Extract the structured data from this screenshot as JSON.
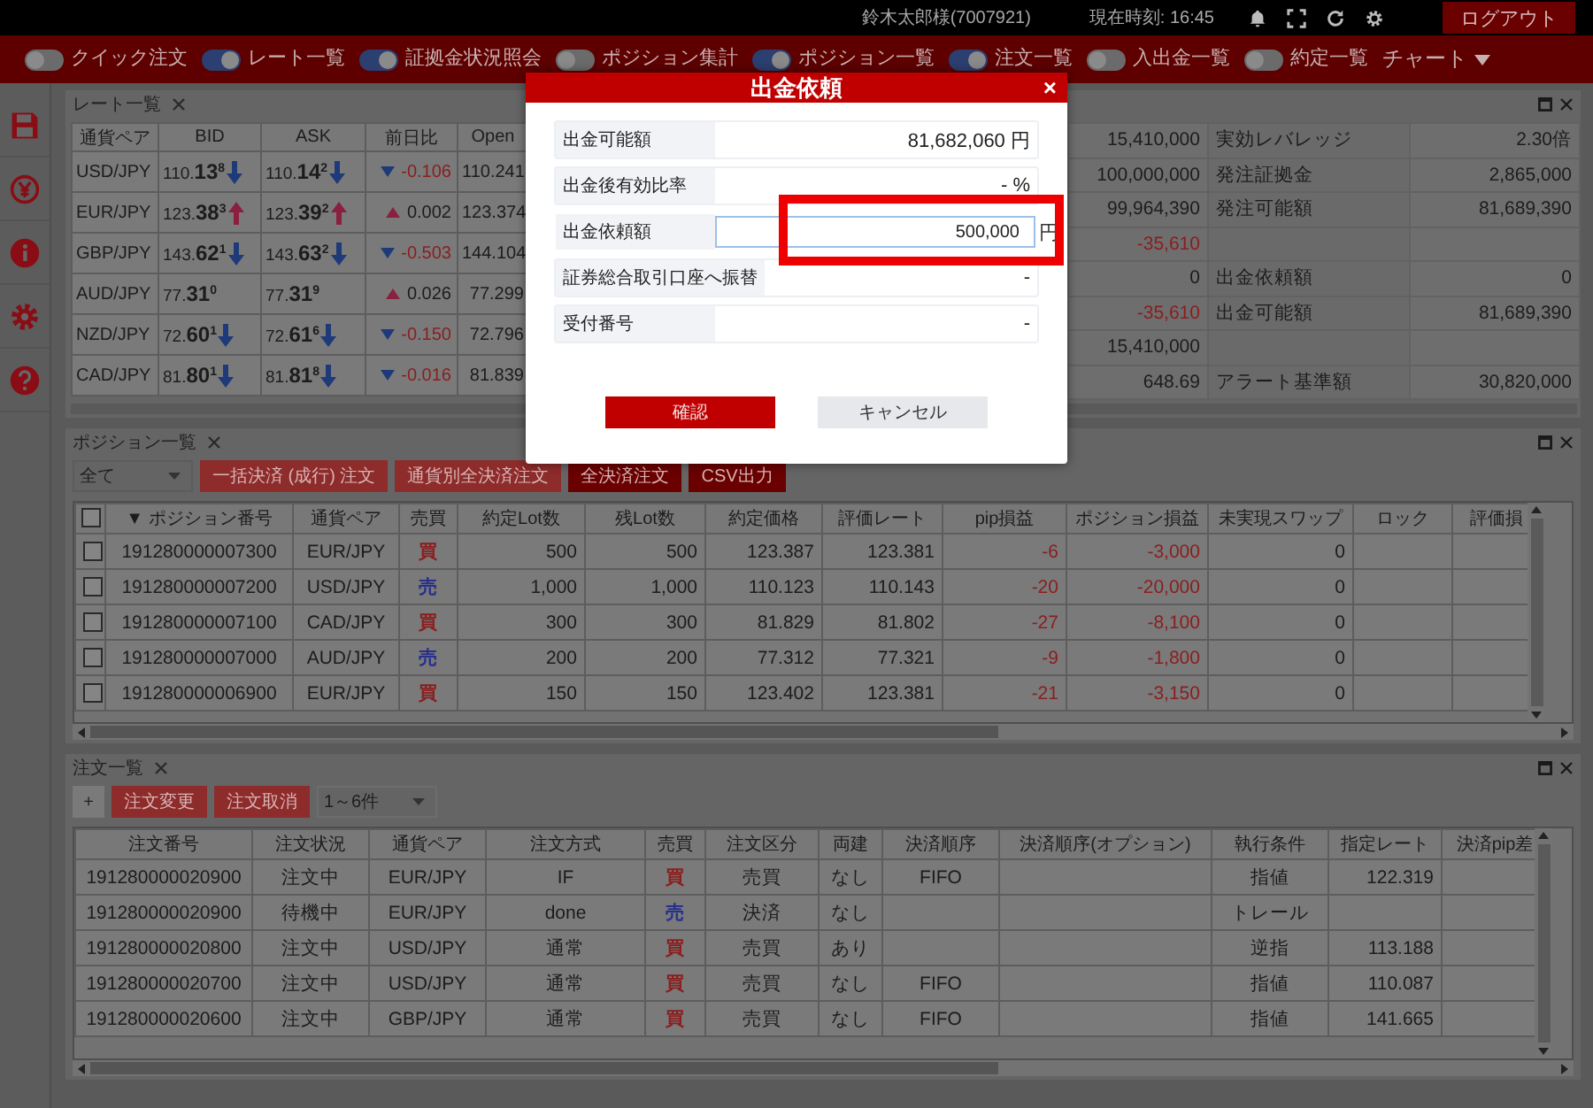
{
  "topbar": {
    "user": "鈴木太郎様(7007921)",
    "clock": "現在時刻: 16:45",
    "logout": "ログアウト"
  },
  "navbar": {
    "toggles": [
      {
        "label": "クイック注文",
        "on": false
      },
      {
        "label": "レート一覧",
        "on": true
      },
      {
        "label": "証拠金状況照会",
        "on": true
      },
      {
        "label": "ポジション集計",
        "on": false
      },
      {
        "label": "ポジション一覧",
        "on": true
      },
      {
        "label": "注文一覧",
        "on": true
      },
      {
        "label": "入出金一覧",
        "on": false
      },
      {
        "label": "約定一覧",
        "on": false
      }
    ],
    "menu": "チャート"
  },
  "rate_panel": {
    "tab": "レート一覧",
    "columns": [
      "通貨ペア",
      "BID",
      "ASK",
      "前日比",
      "Open"
    ],
    "rows": [
      {
        "pair": "USD/JPY",
        "bid": {
          "prefix": "110.",
          "big": "13",
          "sup": "8",
          "kind": "down"
        },
        "ask": {
          "prefix": "110.",
          "big": "14",
          "sup": "2",
          "kind": "down"
        },
        "change": {
          "kind": "down",
          "value": "-0.106"
        },
        "open": "110.241"
      },
      {
        "pair": "EUR/JPY",
        "bid": {
          "prefix": "123.",
          "big": "38",
          "sup": "3",
          "kind": "up"
        },
        "ask": {
          "prefix": "123.",
          "big": "39",
          "sup": "2",
          "kind": "up"
        },
        "change": {
          "kind": "up",
          "value": "0.002"
        },
        "open": "123.374"
      },
      {
        "pair": "GBP/JPY",
        "bid": {
          "prefix": "143.",
          "big": "62",
          "sup": "1",
          "kind": "down"
        },
        "ask": {
          "prefix": "143.",
          "big": "63",
          "sup": "2",
          "kind": "down"
        },
        "change": {
          "kind": "down",
          "value": "-0.503"
        },
        "open": "144.104"
      },
      {
        "pair": "AUD/JPY",
        "bid": {
          "prefix": "77.",
          "big": "31",
          "sup": "0"
        },
        "ask": {
          "prefix": "77.",
          "big": "31",
          "sup": "9"
        },
        "change": {
          "kind": "up",
          "value": "0.026"
        },
        "open": "77.299"
      },
      {
        "pair": "NZD/JPY",
        "bid": {
          "prefix": "72.",
          "big": "60",
          "sup": "1",
          "kind": "down"
        },
        "ask": {
          "prefix": "72.",
          "big": "61",
          "sup": "6",
          "kind": "down"
        },
        "change": {
          "kind": "down",
          "value": "-0.150"
        },
        "open": "72.796"
      },
      {
        "pair": "CAD/JPY",
        "bid": {
          "prefix": "81.",
          "big": "80",
          "sup": "1",
          "kind": "down"
        },
        "ask": {
          "prefix": "81.",
          "big": "81",
          "sup": "8",
          "kind": "down"
        },
        "change": {
          "kind": "down",
          "value": "-0.016"
        },
        "open": "81.839"
      }
    ]
  },
  "margin_panel": {
    "left_values": [
      {
        "value": "15,410,000",
        "negative": false
      },
      {
        "value": "100,000,000",
        "negative": false
      },
      {
        "value": "99,964,390",
        "negative": false
      },
      {
        "value": "-35,610",
        "negative": true
      },
      {
        "value": "0",
        "negative": false
      },
      {
        "value": "-35,610",
        "negative": true
      },
      {
        "value": "15,410,000",
        "negative": false
      },
      {
        "value": "648.69",
        "negative": false
      }
    ],
    "right_rows": [
      {
        "label": "実効レバレッジ",
        "value": "2.30倍"
      },
      {
        "label": "発注証拠金",
        "value": "2,865,000"
      },
      {
        "label": "発注可能額",
        "value": "81,689,390"
      },
      {},
      {
        "label": "出金依頼額",
        "value": "0"
      },
      {
        "label": "出金可能額",
        "value": "81,689,390"
      },
      {},
      {
        "label": "アラート基準額",
        "value": "30,820,000"
      }
    ]
  },
  "position_panel": {
    "tab": "ポジション一覧",
    "filter": "全て",
    "buttons": [
      {
        "label": "一括決済 (成行) 注文",
        "kind": "light"
      },
      {
        "label": "通貨別全決済注文",
        "kind": "light"
      },
      {
        "label": "全決済注文",
        "kind": "dark"
      },
      {
        "label": "CSV出力",
        "kind": "dark"
      }
    ],
    "all_checked": false,
    "columns": [
      "▼ ポジション番号",
      "通貨ペア",
      "売買",
      "約定Lot数",
      "残Lot数",
      "約定価格",
      "評価レート",
      "pip損益",
      "ポジション損益",
      "未実現スワップ",
      "ロック",
      "評価損"
    ],
    "rows": [
      {
        "checked": false,
        "cells": [
          "191280000007300",
          "EUR/JPY",
          "買",
          "500",
          "500",
          "123.387",
          "123.381",
          "-6",
          "-3,000",
          "0"
        ],
        "kind": "buy",
        "loss": true
      },
      {
        "checked": false,
        "cells": [
          "191280000007200",
          "USD/JPY",
          "売",
          "1,000",
          "1,000",
          "110.123",
          "110.143",
          "-20",
          "-20,000",
          "0"
        ],
        "kind": "sell",
        "loss": true
      },
      {
        "checked": false,
        "cells": [
          "191280000007100",
          "CAD/JPY",
          "買",
          "300",
          "300",
          "81.829",
          "81.802",
          "-27",
          "-8,100",
          "0"
        ],
        "kind": "buy",
        "loss": true
      },
      {
        "checked": false,
        "cells": [
          "191280000007000",
          "AUD/JPY",
          "売",
          "200",
          "200",
          "77.312",
          "77.321",
          "-9",
          "-1,800",
          "0"
        ],
        "kind": "sell",
        "loss": true
      },
      {
        "checked": false,
        "cells": [
          "191280000006900",
          "EUR/JPY",
          "買",
          "150",
          "150",
          "123.402",
          "123.381",
          "-21",
          "-3,150",
          "0"
        ],
        "kind": "buy",
        "loss": true
      }
    ]
  },
  "order_panel": {
    "tab": "注文一覧",
    "add": "+",
    "buttons": [
      "注文変更",
      "注文取消"
    ],
    "range": "1～6件",
    "columns": [
      "注文番号",
      "注文状況",
      "通貨ペア",
      "注文方式",
      "売買",
      "注文区分",
      "両建",
      "決済順序",
      "決済順序(オプション)",
      "執行条件",
      "指定レート",
      "決済pip差"
    ],
    "rows": [
      {
        "cells": [
          "191280000020900",
          "注文中",
          "EUR/JPY",
          "IF",
          "買",
          "売買",
          "なし",
          "FIFO",
          "",
          "指値",
          "122.319",
          ""
        ],
        "kind": "buy"
      },
      {
        "cells": [
          "191280000020900",
          "待機中",
          "EUR/JPY",
          "done",
          "売",
          "決済",
          "なし",
          "",
          "",
          "トレール",
          "",
          ""
        ],
        "kind": "sell"
      },
      {
        "cells": [
          "191280000020800",
          "注文中",
          "USD/JPY",
          "通常",
          "買",
          "売買",
          "あり",
          "",
          "",
          "逆指",
          "113.188",
          ""
        ],
        "kind": "buy"
      },
      {
        "cells": [
          "191280000020700",
          "注文中",
          "USD/JPY",
          "通常",
          "買",
          "売買",
          "なし",
          "FIFO",
          "",
          "指値",
          "110.087",
          ""
        ],
        "kind": "buy"
      },
      {
        "cells": [
          "191280000020600",
          "注文中",
          "GBP/JPY",
          "通常",
          "買",
          "売買",
          "なし",
          "FIFO",
          "",
          "指値",
          "141.665",
          ""
        ],
        "kind": "buy"
      }
    ]
  },
  "dialog": {
    "title": "出金依頼",
    "close": "×",
    "fields": [
      {
        "label": "出金可能額",
        "kind": "text",
        "value": "81,682,060 円"
      },
      {
        "label": "出金後有効比率",
        "kind": "text",
        "value": "- %"
      },
      {
        "label": "出金依頼額",
        "kind": "input",
        "value": "500,000",
        "unit": "円"
      },
      {
        "label": "証券総合取引口座へ振替",
        "kind": "text",
        "value": "-"
      },
      {
        "label": "受付番号",
        "kind": "text",
        "value": "-"
      }
    ],
    "confirm": "確認",
    "cancel": "キャンセル",
    "highlight": true
  }
}
